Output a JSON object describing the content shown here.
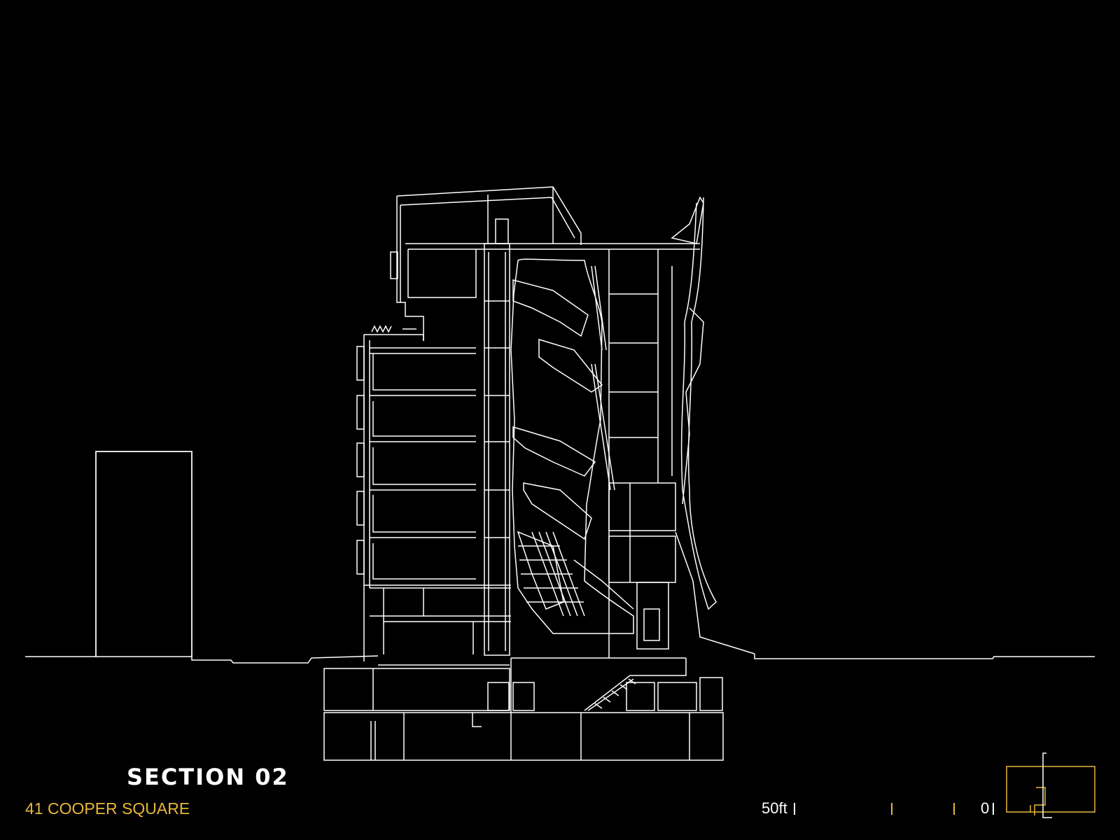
{
  "title": "SECTION 02",
  "subtitle": "41 COOPER SQUARE",
  "scale_bar": {
    "label_start": "50ft",
    "label_end": "0"
  },
  "colors": {
    "background": "#000000",
    "linework": "#ffffff",
    "accent": "#e8b73a"
  }
}
